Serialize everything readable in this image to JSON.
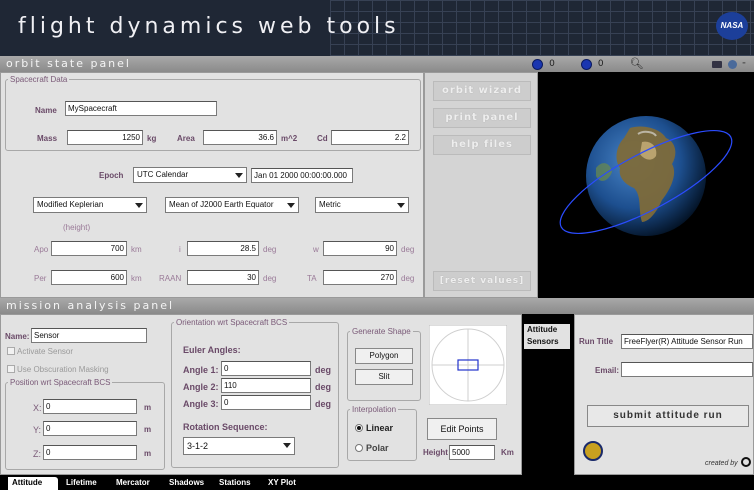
{
  "app": {
    "title": "flight dynamics web tools",
    "logo": "NASA"
  },
  "orbit": {
    "bar_title": "orbit state panel",
    "toolbar": {
      "count1": "0",
      "count2": "0"
    },
    "spacecraft_data": {
      "legend": "Spacecraft Data",
      "name_label": "Name",
      "name": "MySpacecraft",
      "mass_label": "Mass",
      "mass": "1250",
      "mass_unit": "kg",
      "area_label": "Area",
      "area": "36.6",
      "area_unit": "m^2",
      "cd_label": "Cd",
      "cd": "2.2"
    },
    "epoch_label": "Epoch",
    "epoch_format": "UTC Calendar",
    "epoch_value": "Jan 01 2000 00:00:00.000",
    "elements_type": "Modified Keplerian",
    "frame": "Mean of J2000 Earth Equator",
    "units": "Metric",
    "height_note": "(height)",
    "apo_label": "Apo",
    "apo": "700",
    "apo_unit": "km",
    "per_label": "Per",
    "per": "600",
    "per_unit": "km",
    "i_label": "i",
    "i": "28.5",
    "i_unit": "deg",
    "raan_label": "RAAN",
    "raan": "30",
    "raan_unit": "deg",
    "w_label": "w",
    "w": "90",
    "w_unit": "deg",
    "ta_label": "TA",
    "ta": "270",
    "ta_unit": "deg",
    "buttons": {
      "wizard": "orbit wizard",
      "print": "print panel",
      "help": "help files",
      "reset": "[reset values]"
    }
  },
  "mission": {
    "bar_title": "mission analysis panel",
    "name_label": "Name:",
    "name": "Sensor",
    "activate": "Activate Sensor",
    "obscuration": "Use Obscuration Masking",
    "position": {
      "legend": "Position wrt Spacecraft BCS",
      "x_label": "X:",
      "x": "0",
      "y_label": "Y:",
      "y": "0",
      "z_label": "Z:",
      "z": "0",
      "unit": "m"
    },
    "orientation": {
      "legend": "Orientation wrt Spacecraft BCS",
      "euler_label": "Euler Angles:",
      "a1_label": "Angle 1:",
      "a1": "0",
      "a2_label": "Angle 2:",
      "a2": "110",
      "a3_label": "Angle 3:",
      "a3": "0",
      "unit": "deg",
      "sequence_label": "Rotation Sequence:",
      "sequence": "3-1-2"
    },
    "shape": {
      "legend": "Generate Shape",
      "polygon": "Polygon",
      "slit": "Slit"
    },
    "interp": {
      "legend": "Interpolation",
      "linear": "Linear",
      "polar": "Polar"
    },
    "edit_points": "Edit Points",
    "height_label": "Height",
    "height": "5000",
    "height_unit": "Km"
  },
  "side_tabs": {
    "attitude": "Attitude",
    "sensors": "Sensors"
  },
  "run": {
    "title_label": "Run Title",
    "title": "FreeFlyer(R) Attitude Sensor Run",
    "email_label": "Email:",
    "email": "",
    "submit": "submit attitude run",
    "credit": "created by"
  },
  "tabs": [
    "Attitude",
    "Lifetime",
    "Mercator",
    "Shadows",
    "Stations",
    "XY Plot"
  ],
  "colors": {
    "banner": "#1f2735",
    "label": "#7a5a78",
    "panel": "#e2e2e2",
    "accent": "#1a36b0"
  }
}
